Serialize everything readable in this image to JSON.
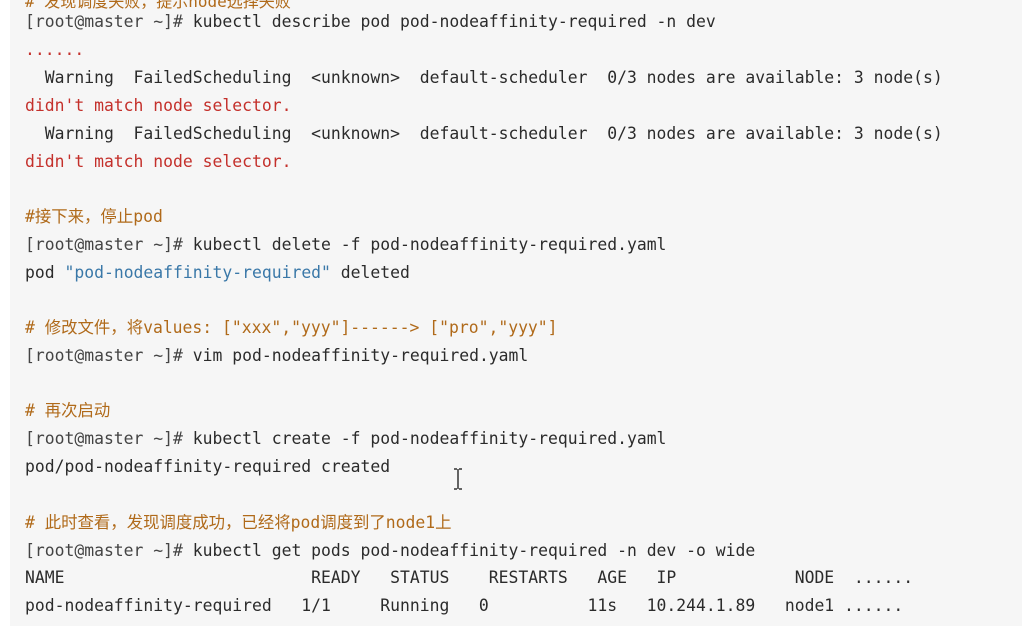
{
  "top_cut_text": "# 发现调度失败，提示node选择失败",
  "lines": [
    {
      "prompt": "[root@master ~]# ",
      "text": "kubectl describe pod pod-nodeaffinity-required -n dev"
    },
    {
      "text": "......"
    },
    {
      "text": "  Warning  FailedScheduling  <unknown>  default-scheduler  0/3 nodes are available: 3 node(s)"
    },
    {
      "text": "didn't match node selector."
    },
    {
      "text": "  Warning  FailedScheduling  <unknown>  default-scheduler  0/3 nodes are available: 3 node(s)"
    },
    {
      "text": "didn't match node selector."
    },
    {
      "text": "#接下来，停止pod"
    },
    {
      "prompt": "[root@master ~]# ",
      "text": "kubectl delete -f pod-nodeaffinity-required.yaml"
    },
    {
      "pre": "pod ",
      "str": "\"pod-nodeaffinity-required\"",
      "post": " deleted"
    },
    {
      "text": "# 修改文件，将values: [\"xxx\",\"yyy\"]------> [\"pro\",\"yyy\"]"
    },
    {
      "prompt": "[root@master ~]# ",
      "text": "vim pod-nodeaffinity-required.yaml"
    },
    {
      "text": "# 再次启动"
    },
    {
      "prompt": "[root@master ~]# ",
      "text": "kubectl create -f pod-nodeaffinity-required.yaml"
    },
    {
      "text": "pod/pod-nodeaffinity-required created"
    },
    {
      "text": "# 此时查看，发现调度成功，已经将pod调度到了node1上"
    },
    {
      "prompt": "[root@master ~]# ",
      "text": "kubectl get pods pod-nodeaffinity-required -n dev -o wide"
    },
    {
      "text": "NAME                         READY   STATUS    RESTARTS   AGE   IP            NODE  ......"
    },
    {
      "text": "pod-nodeaffinity-required   1/1     Running   0          11s   10.244.1.89   node1 ......"
    }
  ]
}
